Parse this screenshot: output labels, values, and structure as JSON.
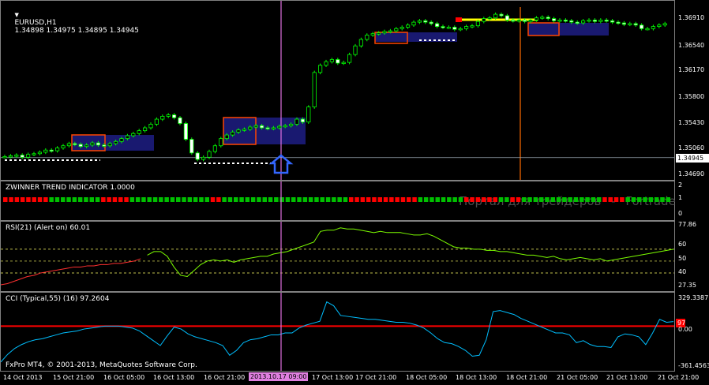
{
  "chart_window": {
    "symbol": "EURUSD,H1",
    "ohlc": "1.34898 1.34975 1.34895 1.34945",
    "price_ticks": [
      "1.36910",
      "1.36540",
      "1.36170",
      "1.35800",
      "1.35430",
      "1.35060",
      "1.34690"
    ],
    "current_price": "1.34945"
  },
  "trend_panel": {
    "title": "ZWINNER TREND INDICATOR 1.0000",
    "ticks": [
      "2",
      "1",
      "0"
    ],
    "watermark": "Портал для трейдеров",
    "watermark_site": "Fortrader.ru",
    "colors": {
      "up": "#00c000",
      "down": "#ff0000"
    }
  },
  "rsi_panel": {
    "title": "RSI(21) (Alert on) 60.01",
    "ticks": [
      "77.86",
      "60",
      "50",
      "40",
      "27.35"
    ]
  },
  "cci_panel": {
    "title": "CCI (Typical,55) (16) 97.2604",
    "ticks": [
      "329.3387",
      "0.00",
      "-361.4563"
    ],
    "current_label": "97",
    "copyright": "FxPro MT4, © 2001-2013, MetaQuotes Software Corp."
  },
  "time_axis": {
    "labels": [
      "14 Oct 2013",
      "15 Oct 21:00",
      "16 Oct 05:00",
      "16 Oct 13:00",
      "16 Oct 21:00",
      "2013.10.17 09:00",
      "17 Oct 13:00",
      "17 Oct 21:00",
      "18 Oct 05:00",
      "18 Oct 13:00",
      "18 Oct 21:00",
      "21 Oct 05:00",
      "21 Oct 13:00",
      "21 Oct 21:00"
    ],
    "highlighted": "2013.10.17 09:00"
  },
  "chart_data": {
    "type": "line",
    "title": "EURUSD,H1",
    "xlabel": "",
    "ylabel": "",
    "ylim": [
      1.3469,
      1.3704
    ],
    "series": [
      {
        "values": [
          1.3496,
          1.3497,
          1.3498,
          1.3495,
          1.3499,
          1.35,
          1.3502,
          1.3505,
          1.3504,
          1.3508,
          1.3511,
          1.3514,
          1.3513,
          1.351,
          1.3512,
          1.3515,
          1.3512,
          1.3511,
          1.3514,
          1.3517,
          1.3521,
          1.3525,
          1.3528,
          1.3532,
          1.3536,
          1.3541,
          1.3548,
          1.3552,
          1.3554,
          1.355,
          1.3542,
          1.352,
          1.3501,
          1.3492,
          1.3495,
          1.3503,
          1.3511,
          1.3521,
          1.3526,
          1.353,
          1.3533,
          1.3534,
          1.3537,
          1.3539,
          1.3536,
          1.3535,
          1.3536,
          1.3538,
          1.3539,
          1.3541,
          1.3548,
          1.3544,
          1.3565,
          1.3613,
          1.3623,
          1.3628,
          1.3631,
          1.3626,
          1.3627,
          1.3638,
          1.365,
          1.3659,
          1.3665,
          1.3667,
          1.3668,
          1.367,
          1.3671,
          1.3674,
          1.3676,
          1.3679,
          1.3683,
          1.3685,
          1.3683,
          1.3681,
          1.3677,
          1.3676,
          1.3676,
          1.3673,
          1.3674,
          1.3677,
          1.3678,
          1.3684,
          1.3688,
          1.3689,
          1.3694,
          1.3692,
          1.3686,
          1.3685,
          1.3686,
          1.3684,
          1.3686,
          1.3689,
          1.369,
          1.3688,
          1.3685,
          1.3686,
          1.3685,
          1.3683,
          1.3682,
          1.3685,
          1.3686,
          1.3684,
          1.3686,
          1.3685,
          1.3683,
          1.3682,
          1.368,
          1.3681,
          1.3679,
          1.3674,
          1.3674,
          1.3677,
          1.3679,
          1.3681
        ]
      }
    ]
  }
}
